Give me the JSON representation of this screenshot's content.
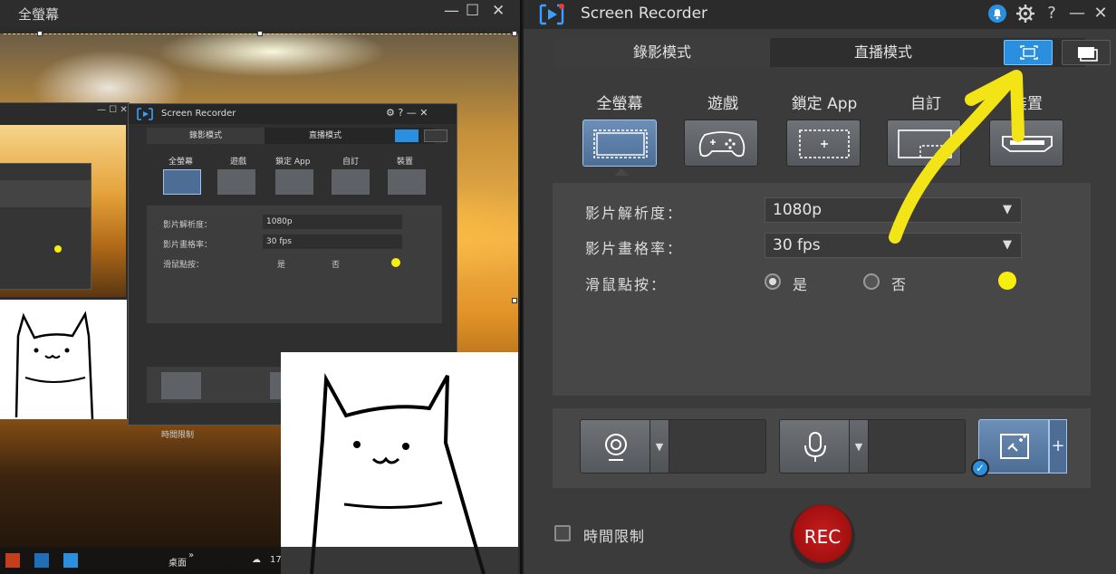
{
  "left_window": {
    "title": "全螢幕",
    "controls": {
      "minimize": "—",
      "maximize": "☐",
      "close": "✕"
    },
    "mini_recorder": {
      "title": "Screen Recorder",
      "tabs": [
        "錄影模式",
        "直播模式"
      ],
      "capture_modes": [
        "全螢幕",
        "遊戲",
        "鎖定 App",
        "自訂",
        "裝置"
      ],
      "settings": [
        {
          "label": "影片解析度：",
          "value": "1080p"
        },
        {
          "label": "影片畫格率：",
          "value": "30 fps"
        },
        {
          "label": "滑鼠點按：",
          "yes": "是",
          "no": "否"
        }
      ],
      "time_limit": "時間限制"
    },
    "taskbar": {
      "desktop": "桌面",
      "chevron": "»",
      "temp": "17"
    }
  },
  "recorder": {
    "title": "Screen Recorder",
    "title_buttons": {
      "help": "?",
      "minimize": "—",
      "close": "✕"
    },
    "tabs": {
      "record": "錄影模式",
      "live": "直播模式"
    },
    "capture_modes": [
      {
        "label": "全螢幕",
        "active": true
      },
      {
        "label": "遊戲",
        "active": false
      },
      {
        "label": "鎖定 App",
        "active": false
      },
      {
        "label": "自訂",
        "active": false
      },
      {
        "label": "裝置",
        "active": false
      }
    ],
    "resolution": {
      "label": "影片解析度：",
      "value": "1080p"
    },
    "framerate": {
      "label": "影片畫格率：",
      "value": "30 fps"
    },
    "mouse_click": {
      "label": "滑鼠點按：",
      "yes": "是",
      "no": "否",
      "selected": "是",
      "highlight_color": "#f7ee0f"
    },
    "devices": {
      "fx_plus": "+"
    },
    "time_limit": {
      "label": "時間限制",
      "checked": false
    },
    "rec_button": "REC",
    "accent_color": "#2b8fe0",
    "annotation_color": "#f2e416"
  }
}
